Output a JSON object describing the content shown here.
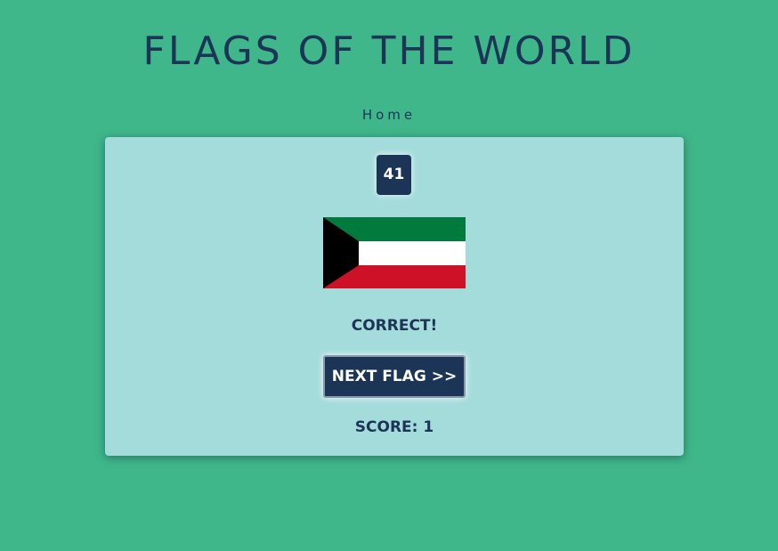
{
  "header": {
    "title": "FLAGS OF THE WORLD",
    "nav_home": "Home"
  },
  "game": {
    "flag_number": "41",
    "flag_icon": "kuwait-flag",
    "flag_colors": {
      "green": "#007a3d",
      "white": "#ffffff",
      "red": "#ce1126",
      "black": "#000000"
    },
    "result": "CORRECT!",
    "next_button_label": "NEXT FLAG >>",
    "score": "SCORE: 1"
  },
  "colors": {
    "background": "#3fb78a",
    "card": "#a4dbdb",
    "navy": "#1c3557"
  }
}
